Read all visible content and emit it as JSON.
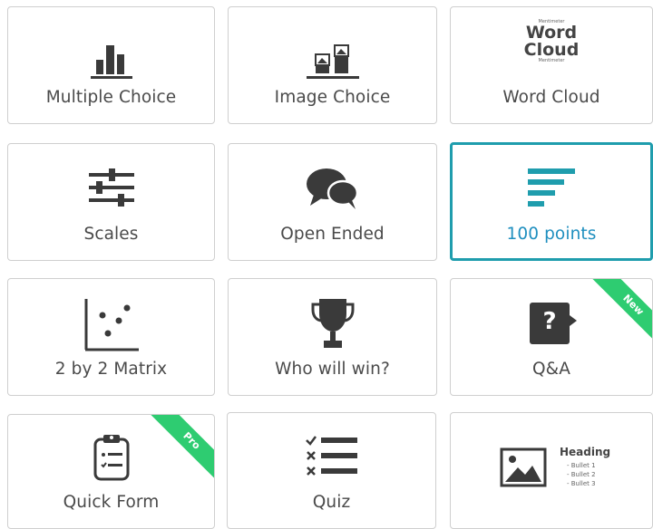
{
  "tiles": [
    {
      "label": "Multiple Choice"
    },
    {
      "label": "Image Choice"
    },
    {
      "label": "Word Cloud",
      "icon_text": {
        "top": "Mentimeter",
        "word": "Word",
        "cloud": "Cloud",
        "side": "Word",
        "bottom": "Mentimeter"
      }
    },
    {
      "label": "Scales"
    },
    {
      "label": "Open Ended"
    },
    {
      "label": "100 points",
      "selected": true
    },
    {
      "label": "2 by 2 Matrix"
    },
    {
      "label": "Who will win?"
    },
    {
      "label": "Q&A",
      "badge": "New",
      "icon_text": "?"
    },
    {
      "label": "Quick Form",
      "badge": "Pro"
    },
    {
      "label": "Quiz"
    },
    {
      "label": "",
      "icon_text": {
        "heading": "Heading",
        "bullets": [
          "- Bullet 1",
          "- Bullet 2",
          "- Bullet 3"
        ]
      }
    }
  ],
  "colors": {
    "accent": "#1f9dad",
    "icon": "#3a3a3a",
    "badge": "#2ecc71"
  },
  "icons": [
    "bar-chart-icon",
    "image-choice-icon",
    "word-cloud-icon",
    "sliders-icon",
    "speech-bubbles-icon",
    "horizontal-bars-icon",
    "scatter-matrix-icon",
    "trophy-icon",
    "question-bubble-icon",
    "clipboard-form-icon",
    "quiz-checklist-icon",
    "image-bullets-icon"
  ]
}
